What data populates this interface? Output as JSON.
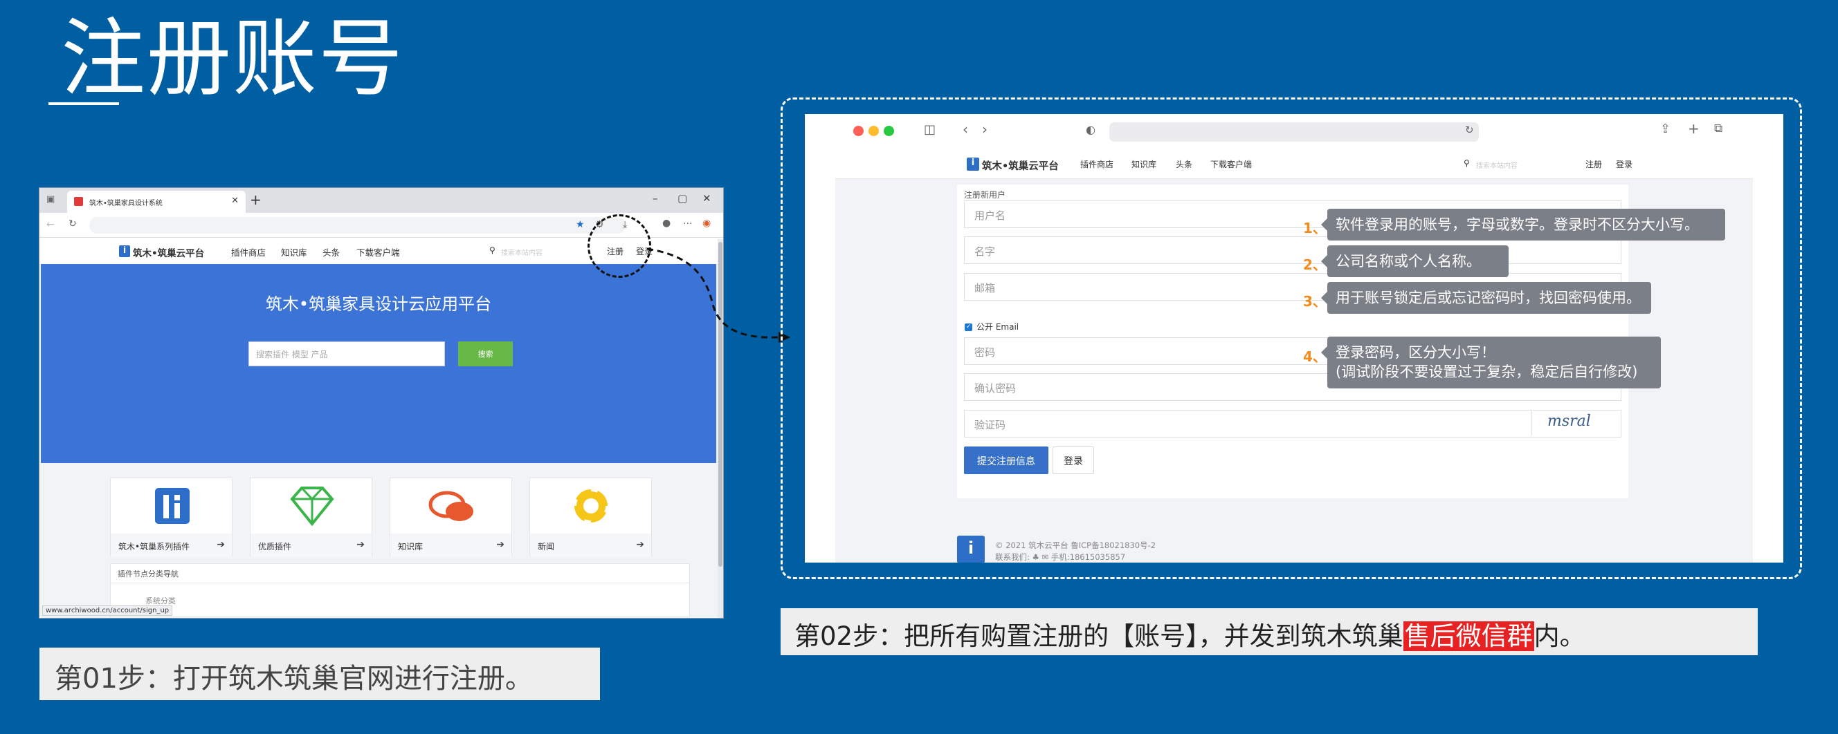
{
  "slide": {
    "title": "注册账号"
  },
  "left_browser": {
    "tab_title": "筑木•筑巢家具设计系统",
    "new_tab": "+",
    "window_controls": [
      "–",
      "▢",
      "✕"
    ],
    "nav": {
      "logo_mark": "i",
      "logo": "筑木•筑巢云平台",
      "items": [
        "插件商店",
        "知识库",
        "头条",
        "下载客户端"
      ],
      "search_placeholder": "搜索本站内容",
      "register": "注册",
      "login": "登录"
    },
    "hero": {
      "title": "筑木•筑巢家具设计云应用平台",
      "search_placeholder": "搜索插件 模型 产品",
      "search_button": "搜索"
    },
    "cards": [
      {
        "label": "筑木•筑巢系列插件",
        "icon": "zhumu-logo-icon"
      },
      {
        "label": "优质插件",
        "icon": "diamond-icon"
      },
      {
        "label": "知识库",
        "icon": "chat-bubbles-icon"
      },
      {
        "label": "新闻",
        "icon": "lifebuoy-icon"
      }
    ],
    "category": {
      "header": "插件节点分类导航",
      "item": "系统分类"
    },
    "status_url": "www.archiwood.cn/account/sign_up"
  },
  "step1": "第01步：打开筑木筑巢官网进行注册。",
  "right_browser": {
    "nav": {
      "logo_mark": "i",
      "logo": "筑木•筑巢云平台",
      "items": [
        "插件商店",
        "知识库",
        "头条",
        "下载客户端"
      ],
      "search_placeholder": "搜索本站内容",
      "register": "注册",
      "login": "登录"
    },
    "form": {
      "header": "注册新用户",
      "username": "用户名",
      "name": "名字",
      "email": "邮箱",
      "public_email": "公开 Email",
      "password": "密码",
      "confirm_password": "确认密码",
      "captcha": "验证码",
      "captcha_image": "msral",
      "submit": "提交注册信息",
      "login": "登录"
    },
    "footer": {
      "logo_mark": "i",
      "line1": "© 2021 筑木云平台 鲁ICP备18021830号-2",
      "line2": "联系我们: ♣ ✉ 手机:18615035857"
    }
  },
  "annotations": [
    {
      "num": "1、",
      "text": "软件登录用的账号，字母或数字。登录时不区分大小写。"
    },
    {
      "num": "2、",
      "text": "公司名称或个人名称。"
    },
    {
      "num": "3、",
      "text": "用于账号锁定后或忘记密码时，找回密码使用。"
    },
    {
      "num": "4、",
      "text": "登录密码，区分大小写！",
      "text2": "(调试阶段不要设置过于复杂，稳定后自行修改)"
    }
  ],
  "step2": {
    "before": "第02步：把所有购置注册的【账号】，并发到筑木筑巢",
    "highlight": "售后微信群",
    "after": "内。"
  },
  "colors": {
    "background": "#005fa3",
    "hero": "#3b74d6",
    "search_button": "#67b846",
    "submit": "#3670c8",
    "highlight": "#e82222",
    "note": "#7b7f87",
    "number": "#f28c1e"
  }
}
